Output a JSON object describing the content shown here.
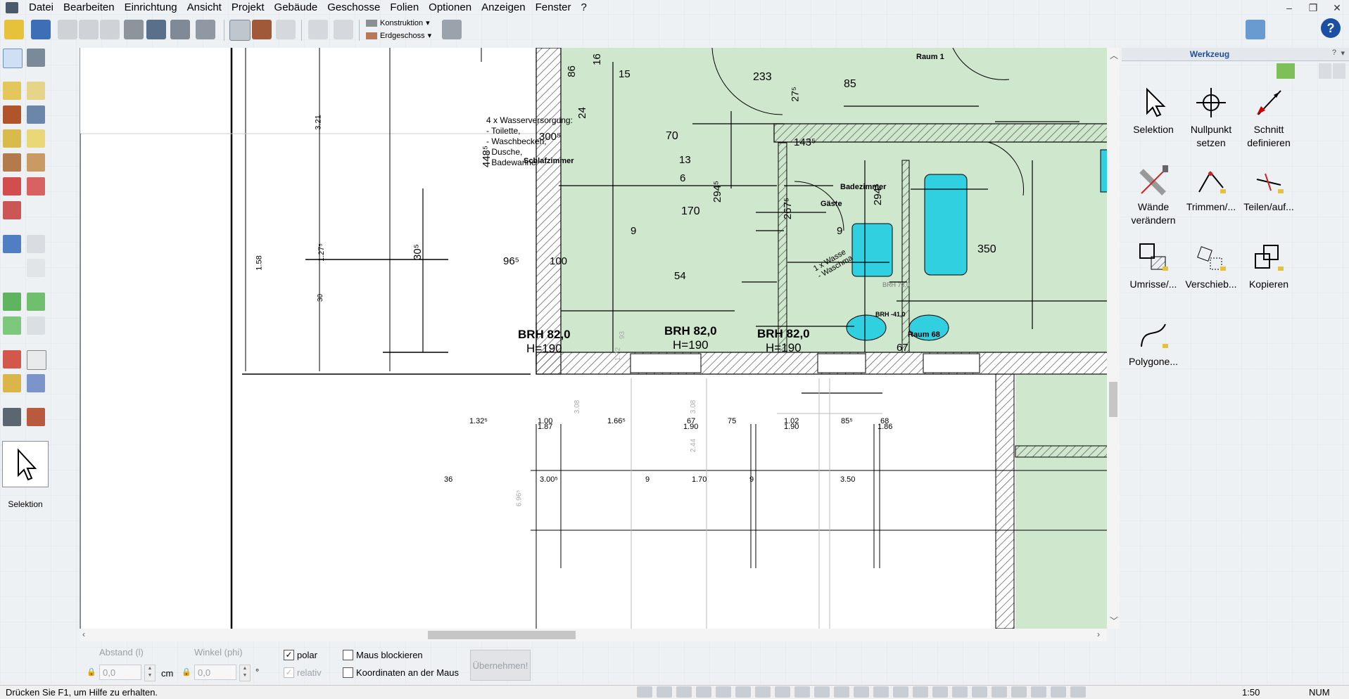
{
  "menu": [
    "Datei",
    "Bearbeiten",
    "Einrichtung",
    "Ansicht",
    "Projekt",
    "Gebäude",
    "Geschosse",
    "Folien",
    "Optionen",
    "Anzeigen",
    "Fenster",
    "?"
  ],
  "toolbar": {
    "construction_dropdown": "Konstruktion",
    "floor_dropdown": "Erdgeschoss"
  },
  "left_palette": {
    "current_tool_label": "Selektion"
  },
  "drawing": {
    "rooms": {
      "schlafzimmer": "Schlafzimmer",
      "badezimmer": "Badezimmer",
      "gaeste": "Gäste",
      "raum1": "Raum 1",
      "raum68": "Raum 68"
    },
    "note_lines": [
      "4 x Wasserversorgung:",
      "- Toilette,",
      "- Waschbecken,",
      "- Dusche,",
      "- Badewanne"
    ],
    "note2_lines": [
      "1 x Wasse",
      "- Waschma"
    ],
    "brh": [
      {
        "brh": "BRH 82,0",
        "h": "H=190"
      },
      {
        "brh": "BRH 82,0",
        "h": "H=190"
      },
      {
        "brh": "BRH 82,0",
        "h": "H=190"
      }
    ],
    "small_brh": [
      "BRH 76,0",
      "BRH -41,0"
    ],
    "dims": {
      "d86": "86",
      "d16": "16",
      "d15": "15",
      "d233": "233",
      "d275": "27⁵",
      "d85": "85",
      "d24": "24",
      "d3005": "300⁵",
      "d4485": "448⁵",
      "d70": "70",
      "d1435": "143⁵",
      "d13": "13",
      "d6": "6",
      "d170": "170",
      "d2945": "294⁵",
      "d2675": "267⁵",
      "d2945b": "294⁵",
      "d9": "9",
      "d9b": "9",
      "d350": "350",
      "d965": "96⁵",
      "d100": "100",
      "d54": "54",
      "d305": "30⁵",
      "d67": "67",
      "d321": "3.21",
      "d158": "1.58",
      "d1275": "1.27⁵",
      "d30": "30"
    },
    "chain1": [
      "1.32⁵",
      "1.00",
      "1.87",
      "1.66⁵",
      "67",
      "1.90",
      "75",
      "1.02",
      "1.90",
      "85⁵",
      "68",
      "1.86"
    ],
    "chain2": [
      "36",
      "3.00⁵",
      "9",
      "1.70",
      "9",
      "3.50"
    ],
    "faint": [
      "3.08",
      "6.96⁵",
      "2.44",
      "3.08",
      "1.72",
      "93"
    ]
  },
  "inputbar": {
    "distance_label": "Abstand (l)",
    "distance_value": "0,0",
    "distance_unit": "cm",
    "angle_label": "Winkel (phi)",
    "angle_value": "0,0",
    "angle_unit": "°",
    "polar_label": "polar",
    "relative_label": "relativ",
    "block_mouse_label": "Maus blockieren",
    "coords_label": "Koordinaten an der Maus",
    "apply_label": "Übernehmen!"
  },
  "right_panel": {
    "title": "Werkzeug",
    "tools": [
      {
        "label": "Selektion"
      },
      {
        "label": "Nullpunkt setzen"
      },
      {
        "label": "Schnitt definieren"
      },
      {
        "label": "Wände verändern"
      },
      {
        "label": "Trimmen/..."
      },
      {
        "label": "Teilen/auf..."
      },
      {
        "label": "Umrisse/..."
      },
      {
        "label": "Verschieb..."
      },
      {
        "label": "Kopieren"
      },
      {
        "label": "Polygone..."
      }
    ]
  },
  "status": {
    "hint": "Drücken Sie F1, um Hilfe zu erhalten.",
    "scale": "1:50",
    "numlock": "NUM"
  }
}
